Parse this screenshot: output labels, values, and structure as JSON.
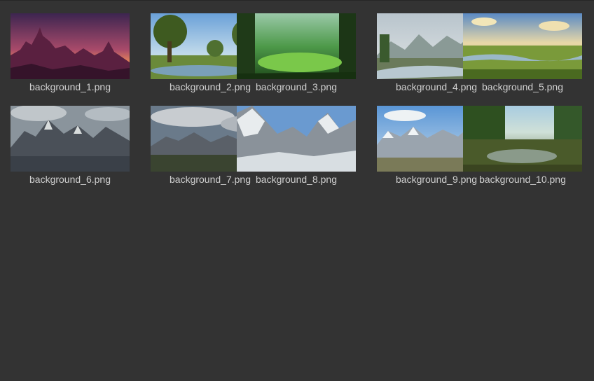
{
  "files": [
    {
      "name": "background_1.png",
      "thumbnail": "purple-castle-sunset"
    },
    {
      "name": "background_2.png",
      "thumbnail": "sunny-meadow-trees-pond"
    },
    {
      "name": "background_3.png",
      "thumbnail": "green-forest-clearing"
    },
    {
      "name": "background_4.png",
      "thumbnail": "mountain-valley-river"
    },
    {
      "name": "background_5.png",
      "thumbnail": "golden-plains-river"
    },
    {
      "name": "background_6.png",
      "thumbnail": "dark-stormy-mountains"
    },
    {
      "name": "background_7.png",
      "thumbnail": "cloudy-mountain-range"
    },
    {
      "name": "background_8.png",
      "thumbnail": "snowy-peaks-close"
    },
    {
      "name": "background_9.png",
      "thumbnail": "snowy-mountain-range"
    },
    {
      "name": "background_10.png",
      "thumbnail": "jungle-pond"
    }
  ]
}
